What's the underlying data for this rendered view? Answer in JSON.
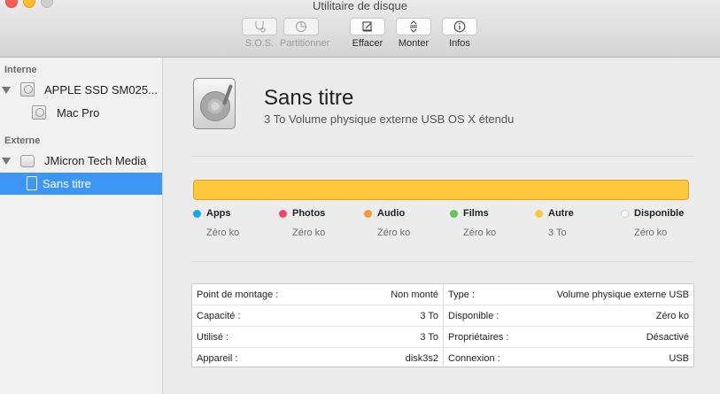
{
  "window": {
    "title": "Utilitaire de disque"
  },
  "toolbar": [
    {
      "label": "S.O.S.",
      "icon": "stethoscope-icon",
      "enabled": false
    },
    {
      "label": "Partitionner",
      "icon": "pie-chart-icon",
      "enabled": false
    },
    {
      "label": "Effacer",
      "icon": "erase-icon",
      "enabled": true
    },
    {
      "label": "Monter",
      "icon": "mount-icon",
      "enabled": true
    },
    {
      "label": "Infos",
      "icon": "info-icon",
      "enabled": true
    }
  ],
  "sidebar": {
    "sections": [
      {
        "title": "Interne",
        "items": [
          {
            "label": "APPLE SSD SM025...",
            "level": 0,
            "icon": "internal-disk-icon"
          },
          {
            "label": "Mac Pro",
            "level": 1,
            "icon": "internal-volume-icon"
          }
        ]
      },
      {
        "title": "Externe",
        "items": [
          {
            "label": "JMicron Tech Media",
            "level": 0,
            "icon": "external-disk-icon"
          },
          {
            "label": "Sans titre",
            "level": 1,
            "icon": "external-volume-icon",
            "selected": true
          }
        ]
      }
    ]
  },
  "volume": {
    "name": "Sans titre",
    "description": "3 To Volume physique externe USB OS X étendu"
  },
  "usage": {
    "bar_color": "#fdc83e",
    "categories": [
      {
        "name": "Apps",
        "value": "Zéro ko",
        "color": "#1aa7e6"
      },
      {
        "name": "Photos",
        "value": "Zéro ko",
        "color": "#f0466e"
      },
      {
        "name": "Audio",
        "value": "Zéro ko",
        "color": "#f59a34"
      },
      {
        "name": "Films",
        "value": "Zéro ko",
        "color": "#62c957"
      },
      {
        "name": "Autre",
        "value": "3 To",
        "color": "#fdc83e"
      },
      {
        "name": "Disponible",
        "value": "Zéro ko",
        "color": "#ffffff"
      }
    ]
  },
  "info": {
    "left": [
      {
        "key": "Point de montage :",
        "value": "Non monté"
      },
      {
        "key": "Capacité :",
        "value": "3 To"
      },
      {
        "key": "Utilisé :",
        "value": "3 To"
      },
      {
        "key": "Appareil :",
        "value": "disk3s2"
      }
    ],
    "right": [
      {
        "key": "Type :",
        "value": "Volume physique externe USB"
      },
      {
        "key": "Disponible :",
        "value": "Zéro ko"
      },
      {
        "key": "Propriétaires :",
        "value": "Désactivé"
      },
      {
        "key": "Connexion :",
        "value": "USB"
      }
    ]
  }
}
